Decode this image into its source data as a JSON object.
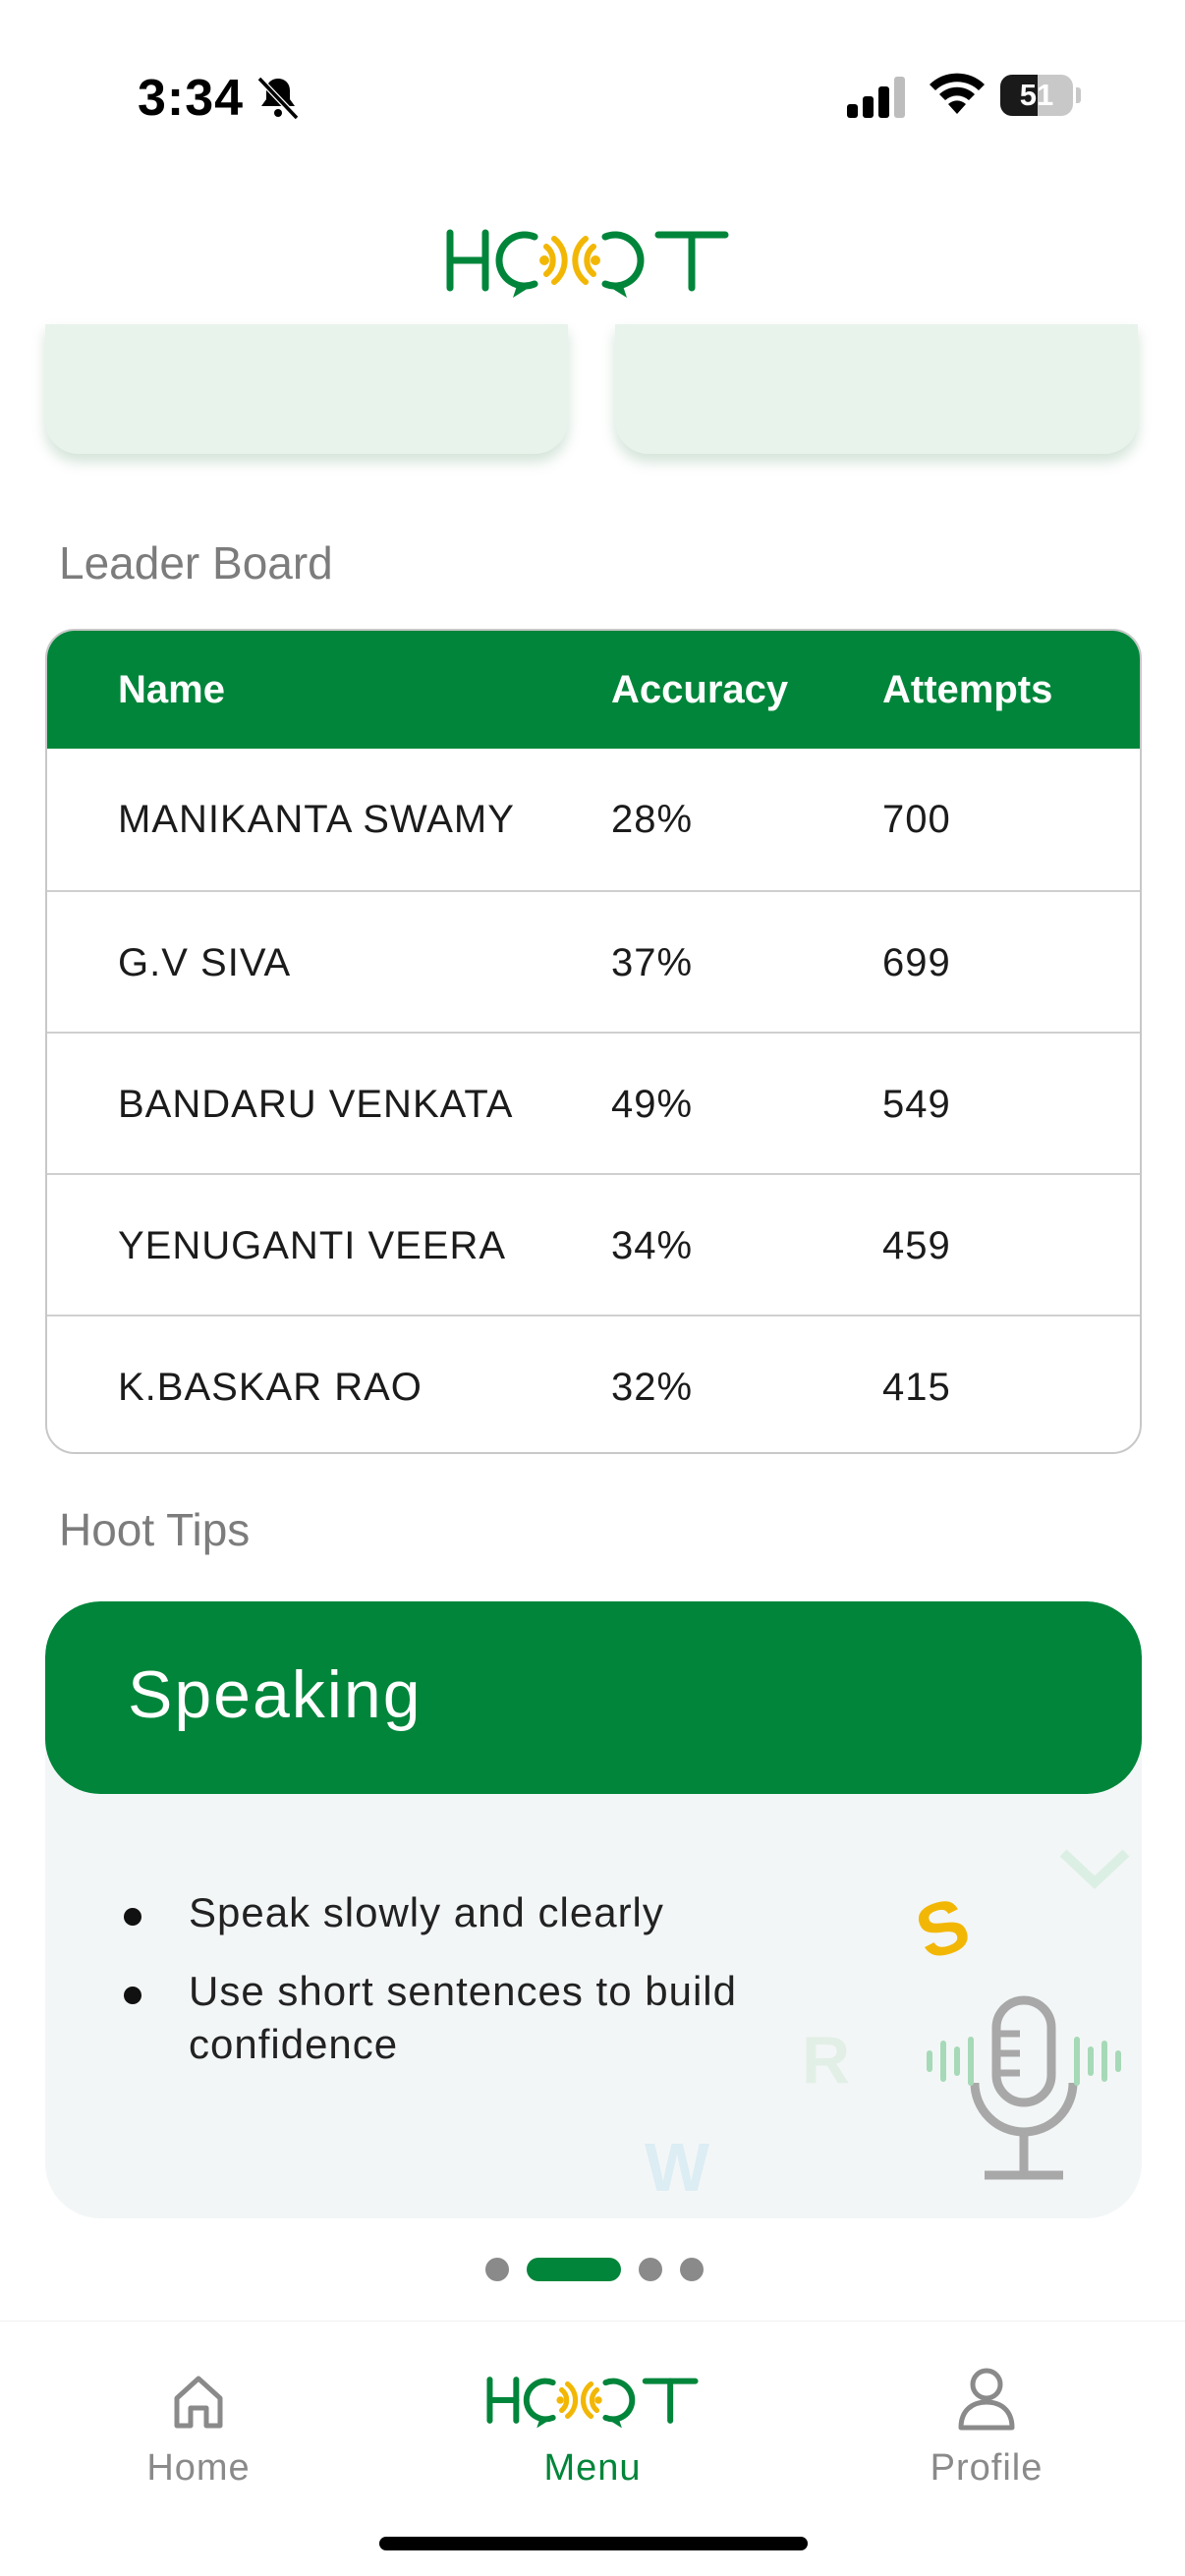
{
  "status_bar": {
    "time": "3:34",
    "battery_level": "51",
    "battery_fraction": 0.51
  },
  "brand": {
    "logo_text": "HOOT",
    "primary_color": "#00853a",
    "accent_color": "#f2b705"
  },
  "leaderboard": {
    "section_title": "Leader Board",
    "columns": [
      "Name",
      "Accuracy",
      "Attempts"
    ],
    "rows": [
      {
        "name": "MANIKANTA SWAMY",
        "accuracy": "28%",
        "attempts": "700"
      },
      {
        "name": "G.V SIVA",
        "accuracy": "37%",
        "attempts": "699"
      },
      {
        "name": "BANDARU VENKATA",
        "accuracy": "49%",
        "attempts": "549"
      },
      {
        "name": "YENUGANTI VEERA",
        "accuracy": "34%",
        "attempts": "459"
      },
      {
        "name": "K.BASKAR RAO",
        "accuracy": "32%",
        "attempts": "415"
      }
    ]
  },
  "tips": {
    "section_title": "Hoot Tips",
    "card_title": "Speaking",
    "items": [
      "Speak slowly and clearly",
      "Use short sentences to build confidence"
    ],
    "decor_letters": [
      "S",
      "R",
      "W"
    ],
    "active_page": 2,
    "page_count": 4
  },
  "bottom_nav": {
    "items": [
      {
        "label": "Home",
        "icon": "home-icon",
        "active": false
      },
      {
        "label": "Menu",
        "icon": "hoot-logo-icon",
        "active": true
      },
      {
        "label": "Profile",
        "icon": "profile-icon",
        "active": false
      }
    ]
  }
}
